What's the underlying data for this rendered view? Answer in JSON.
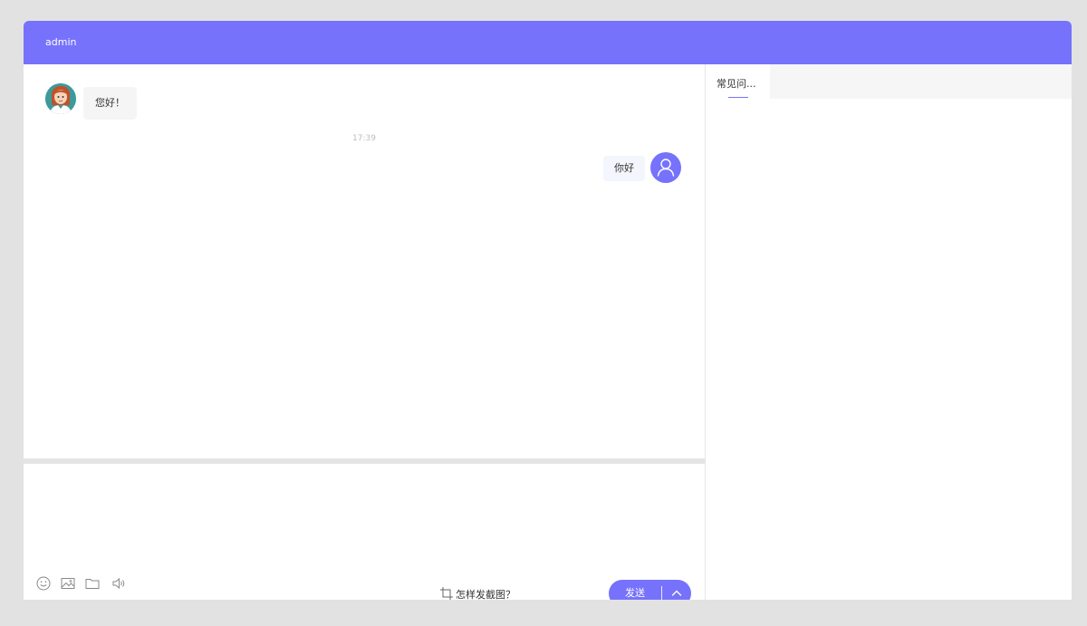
{
  "header": {
    "title": "admin"
  },
  "conversation": {
    "messages": [
      {
        "sender": "agent",
        "text": "您好！"
      },
      {
        "sender": "user",
        "text": "你好"
      }
    ],
    "timestamp": "17:39"
  },
  "side_panel": {
    "tabs": [
      {
        "label": "常见问..."
      }
    ]
  },
  "composer": {
    "toolbar_icons": [
      "smiley-icon",
      "image-icon",
      "folder-icon",
      "speaker-icon"
    ],
    "screenshot_help_label": "怎样发截图？",
    "send_label": "发送"
  },
  "colors": {
    "accent": "#7672fc",
    "page_background": "#e2e2e2",
    "agent_bubble": "#f5f5f5",
    "user_bubble": "#f3f6fc"
  }
}
